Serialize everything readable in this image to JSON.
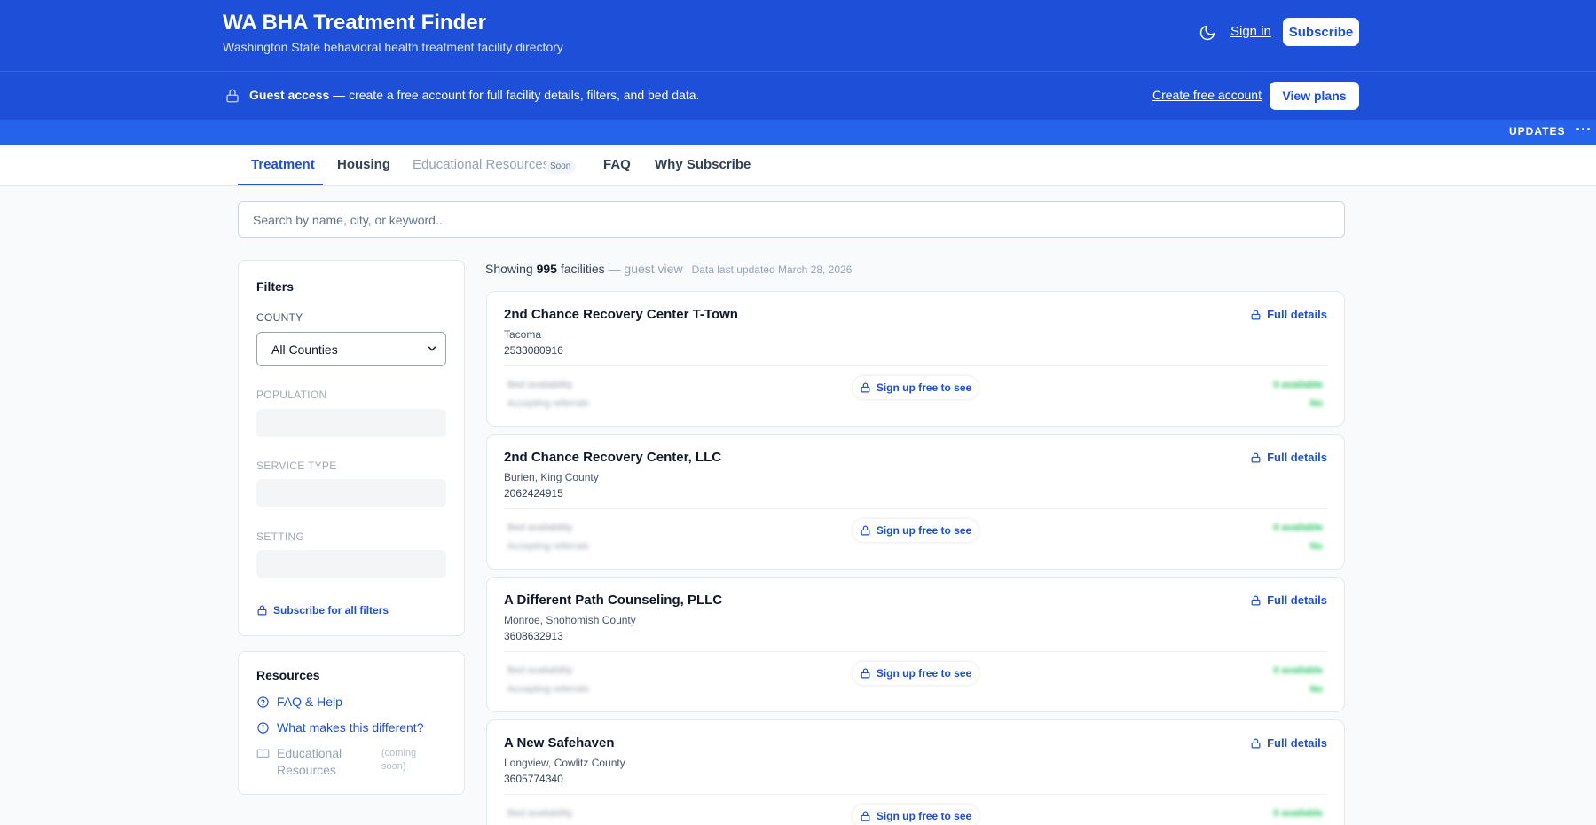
{
  "header": {
    "title": "WA BHA Treatment Finder",
    "subtitle": "Washington State behavioral health treatment facility directory",
    "sign_in": "Sign in",
    "subscribe": "Subscribe"
  },
  "guest_banner": {
    "bold": "Guest access",
    "text": " — create a free account for full facility details, filters, and bed data.",
    "create_account": "Create free account",
    "view_plans": "View plans"
  },
  "updates": {
    "label": "UPDATES",
    "more": "···"
  },
  "tabs": [
    {
      "label": "Treatment"
    },
    {
      "label": "Housing"
    },
    {
      "label": "Educational Resources",
      "badge": "Soon"
    },
    {
      "label": "FAQ"
    },
    {
      "label": "Why Subscribe"
    }
  ],
  "search": {
    "placeholder": "Search by name, city, or keyword..."
  },
  "filters": {
    "title": "Filters",
    "county_label": "COUNTY",
    "county_value": "All Counties",
    "population_label": "POPULATION",
    "service_type_label": "SERVICE TYPE",
    "setting_label": "SETTING",
    "subscribe_link": "Subscribe for all filters"
  },
  "resources": {
    "title": "Resources",
    "faq": "FAQ & Help",
    "different": "What makes this different?",
    "educational": "Educational Resources",
    "coming_soon": "(coming soon)"
  },
  "results": {
    "showing": "Showing ",
    "count": "995",
    "facilities": " facilities",
    "guest_view": " — guest view",
    "updated": "Data last updated March 28, 2026"
  },
  "card_labels": {
    "full_details": "Full details",
    "signup": "Sign up free to see",
    "bed_availability": "Bed availability",
    "accepting_referrals": "Accepting referrals",
    "available": "0 available",
    "no": "No"
  },
  "facilities": [
    {
      "name": "2nd Chance Recovery Center T-Town",
      "location": "Tacoma",
      "phone": "2533080916"
    },
    {
      "name": "2nd Chance Recovery Center, LLC",
      "location": "Burien, King County",
      "phone": "2062424915"
    },
    {
      "name": "A Different Path Counseling, PLLC",
      "location": "Monroe, Snohomish County",
      "phone": "3608632913"
    },
    {
      "name": "A New Safehaven",
      "location": "Longview, Cowlitz County",
      "phone": "3605774340"
    }
  ],
  "colors": {
    "brand": "#1d4fd8",
    "strip": "#2563eb",
    "available_green": "#22c55e"
  }
}
